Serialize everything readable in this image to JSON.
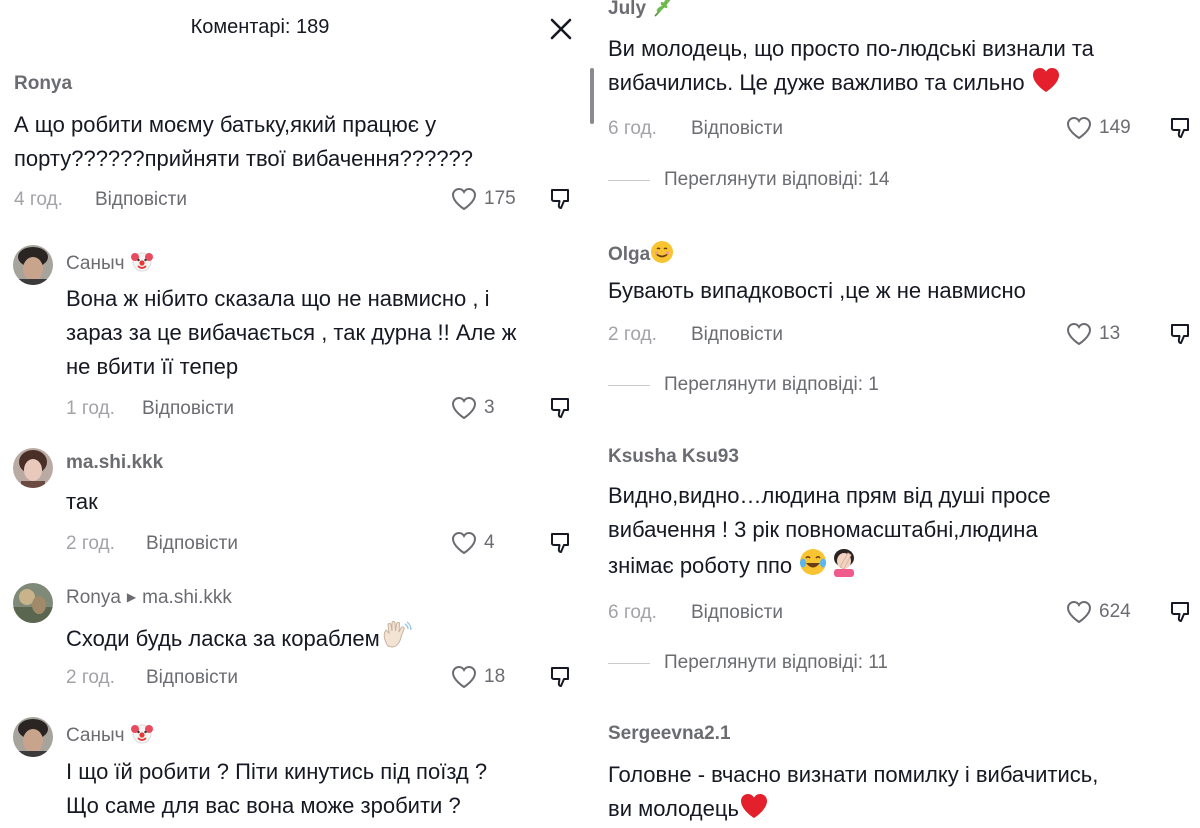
{
  "left": {
    "header_title": "Коментарі: 189",
    "comments": [
      {
        "user": "Ronya",
        "lines": [
          "А що робити моєму батьку,який працює у",
          "порту??????прийняти твої вибачення??????"
        ],
        "time": "4 год.",
        "reply": "Відповісти",
        "likes": "175"
      },
      {
        "user": "Саныч",
        "lines": [
          "Вона ж нібито сказала що не навмисно , і",
          "зараз за це вибачається , так дурна !! Але ж",
          "не вбити її тепер"
        ],
        "time": "1 год.",
        "reply": "Відповісти",
        "likes": "3"
      },
      {
        "user": "ma.shi.kkk",
        "lines": [
          "так"
        ],
        "time": "2 год.",
        "reply": "Відповісти",
        "likes": "4"
      },
      {
        "user": "Ronya",
        "reply_to": "ma.shi.kkk",
        "lines": [
          "Сходи будь ласка за кораблем"
        ],
        "time": "2 год.",
        "reply": "Відповісти",
        "likes": "18"
      },
      {
        "user": "Саныч",
        "lines": [
          "І що їй робити ? Піти кинутись під поїзд ?",
          "Що саме для вас вона може зробити ?"
        ]
      }
    ]
  },
  "right": {
    "comments": [
      {
        "user": "July",
        "lines": [
          "Ви молодець, що просто по-людські визнали та",
          "вибачились. Це дуже важливо та сильно"
        ],
        "time": "6 год.",
        "reply": "Відповісти",
        "likes": "149",
        "view_replies": "Переглянути відповіді: 14"
      },
      {
        "user": "Olga",
        "lines": [
          "Бувають випадковості ,це ж не навмисно"
        ],
        "time": "2 год.",
        "reply": "Відповісти",
        "likes": "13",
        "view_replies": "Переглянути відповіді: 1"
      },
      {
        "user": "Ksusha Ksu93",
        "lines": [
          "Видно,видно…людина прям від душі просе",
          "вибачення ! 3 рік повномасштабні,людина",
          "знімає роботу ппо"
        ],
        "time": "6 год.",
        "reply": "Відповісти",
        "likes": "624",
        "view_replies": "Переглянути відповіді: 11"
      },
      {
        "user": "Sergeevna2.1",
        "lines": [
          "Головне - вчасно визнати помилку і вибачитись,",
          "ви молодець"
        ]
      }
    ]
  },
  "icons": {
    "close": "close-icon",
    "like": "heart-icon",
    "dislike": "thumbs-down-icon",
    "clown": "clown-emoji",
    "wave": "waving-hand-emoji",
    "heart": "red-heart-emoji",
    "smile": "smiling-emoji",
    "laugh": "tears-of-joy-emoji",
    "facepalm": "facepalm-emoji",
    "herb": "herb-emoji"
  }
}
